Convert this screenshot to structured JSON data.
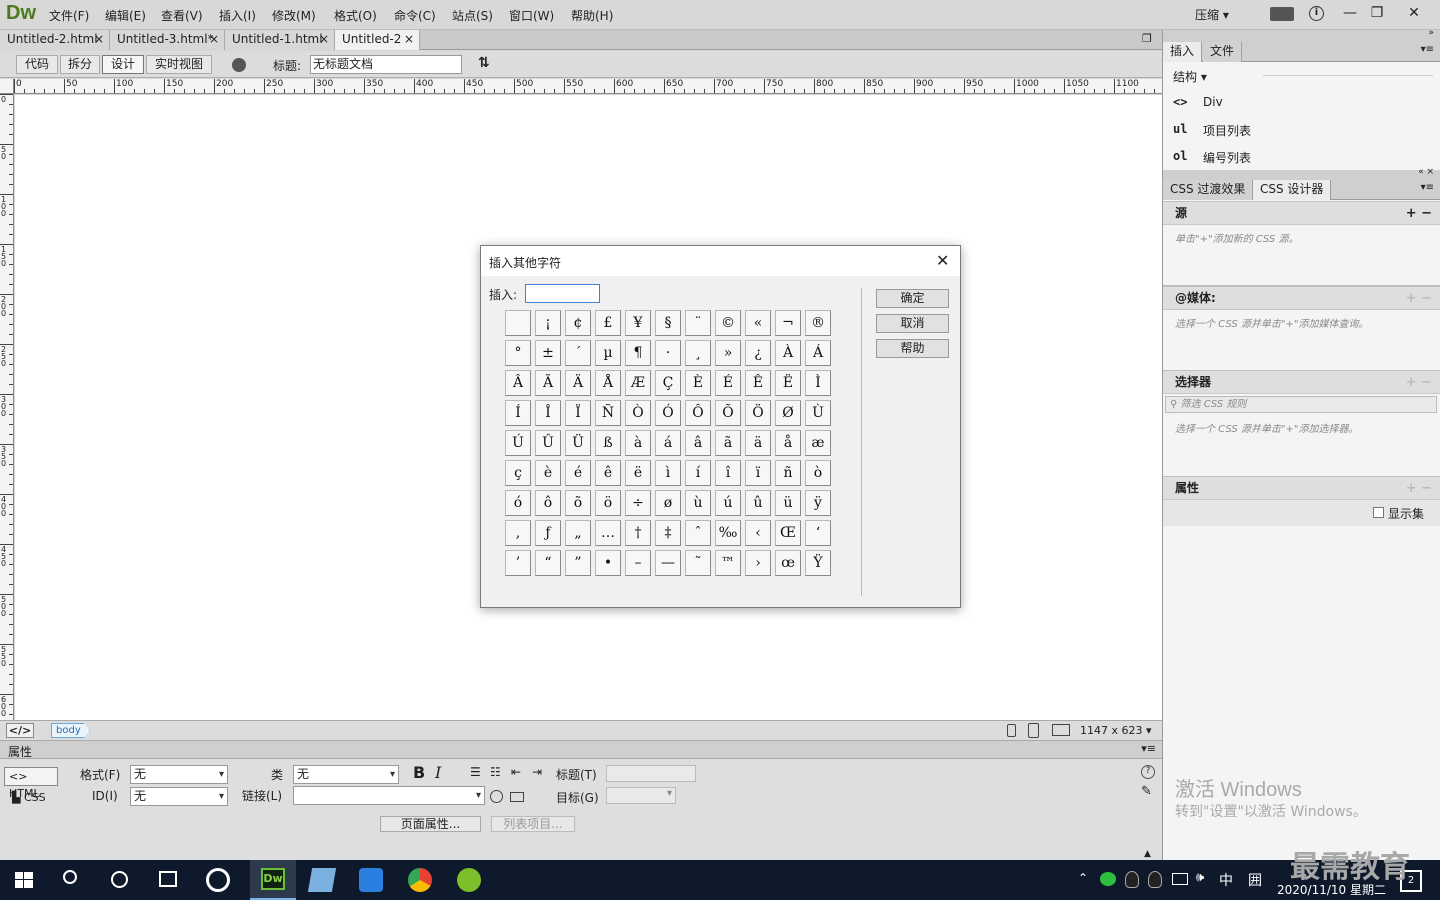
{
  "app": {
    "logo": "Dw"
  },
  "menu": [
    "文件(F)",
    "编辑(E)",
    "查看(V)",
    "插入(I)",
    "修改(M)",
    "格式(O)",
    "命令(C)",
    "站点(S)",
    "窗口(W)",
    "帮助(H)"
  ],
  "window_controls": {
    "compress": "压缩",
    "minimize": "—",
    "restore": "❐",
    "close": "✕"
  },
  "doc_tabs": [
    {
      "label": "Untitled-2.html",
      "active": false
    },
    {
      "label": "Untitled-3.html*",
      "active": false
    },
    {
      "label": "Untitled-1.html",
      "active": false
    },
    {
      "label": "Untitled-2",
      "active": true
    }
  ],
  "toolbar": {
    "code": "代码",
    "split": "拆分",
    "design": "设计",
    "live": "实时视图",
    "title_label": "标题:",
    "title_value": "无标题文档"
  },
  "ruler": {
    "h_labels": [
      "0",
      "50",
      "100",
      "150",
      "200",
      "250",
      "300",
      "350",
      "400",
      "450",
      "500",
      "550",
      "600",
      "650",
      "700",
      "750",
      "800",
      "850",
      "900",
      "950",
      "1000",
      "1050",
      "1100"
    ],
    "v_labels": [
      "0",
      "50",
      "100",
      "150",
      "200",
      "250",
      "300",
      "350",
      "400",
      "450",
      "500",
      "550",
      "600"
    ]
  },
  "statusbar": {
    "tag": "body",
    "size": "1147 x 623"
  },
  "props": {
    "title": "属性",
    "html_btn": "HTML",
    "css_btn": "CSS",
    "format_label": "格式(F)",
    "format_value": "无",
    "class_label": "类",
    "class_value": "无",
    "id_label": "ID(I)",
    "id_value": "无",
    "link_label": "链接(L)",
    "link_value": "",
    "heading_label": "标题(T)",
    "target_label": "目标(G)",
    "page_props": "页面属性...",
    "list_item": "列表项目..."
  },
  "right_panel": {
    "insert_tab": "插入",
    "files_tab": "文件",
    "structure": "结构",
    "items": [
      {
        "tag": "<>",
        "label": "Div"
      },
      {
        "tag": "ul",
        "label": "项目列表"
      },
      {
        "tag": "ol",
        "label": "编号列表"
      }
    ],
    "css_trans_tab": "CSS 过渡效果",
    "css_designer_tab": "CSS 设计器",
    "source_hdr": "源",
    "source_hint": "单击\"+\"添加新的 CSS 源。",
    "media_hdr": "@媒体:",
    "media_hint": "选择一个 CSS 源并单击\"+\"添加媒体查询。",
    "selector_hdr": "选择器",
    "selector_filter": "筛选 CSS 规则",
    "selector_hint": "选择一个 CSS 源并单击\"+\"添加选择器。",
    "props_hdr": "属性",
    "show_set": "显示集",
    "watermark_1": "激活 Windows",
    "watermark_2": "转到\"设置\"以激活 Windows。"
  },
  "dialog": {
    "title": "插入其他字符",
    "insert_label": "插入:",
    "insert_value": "",
    "ok": "确定",
    "cancel": "取消",
    "help": "帮助",
    "chars": [
      [
        "",
        "¡",
        "¢",
        "£",
        "¥",
        "§",
        "¨",
        "©",
        "«",
        "¬",
        "®"
      ],
      [
        "°",
        "±",
        "´",
        "µ",
        "¶",
        "·",
        "¸",
        "»",
        "¿",
        "À",
        "Á"
      ],
      [
        "Â",
        "Ã",
        "Ä",
        "Å",
        "Æ",
        "Ç",
        "È",
        "É",
        "Ê",
        "Ë",
        "Ì"
      ],
      [
        "Í",
        "Î",
        "Ï",
        "Ñ",
        "Ò",
        "Ó",
        "Ô",
        "Õ",
        "Ö",
        "Ø",
        "Ù"
      ],
      [
        "Ú",
        "Û",
        "Ü",
        "ß",
        "à",
        "á",
        "â",
        "ã",
        "ä",
        "å",
        "æ"
      ],
      [
        "ç",
        "è",
        "é",
        "ê",
        "ë",
        "ì",
        "í",
        "î",
        "ï",
        "ñ",
        "ò"
      ],
      [
        "ó",
        "ô",
        "õ",
        "ö",
        "÷",
        "ø",
        "ù",
        "ú",
        "û",
        "ü",
        "ÿ"
      ],
      [
        "‚",
        "ƒ",
        "„",
        "…",
        "†",
        "‡",
        "ˆ",
        "‰",
        "‹",
        "Œ",
        "‘"
      ],
      [
        "’",
        "“",
        "”",
        "•",
        "–",
        "—",
        "˜",
        "™",
        "›",
        "œ",
        "Ÿ"
      ]
    ]
  },
  "taskbar": {
    "lang": "中",
    "ime": "囲",
    "date": "2020/11/10 星期二",
    "notif": "2",
    "brand": "最需教育"
  }
}
